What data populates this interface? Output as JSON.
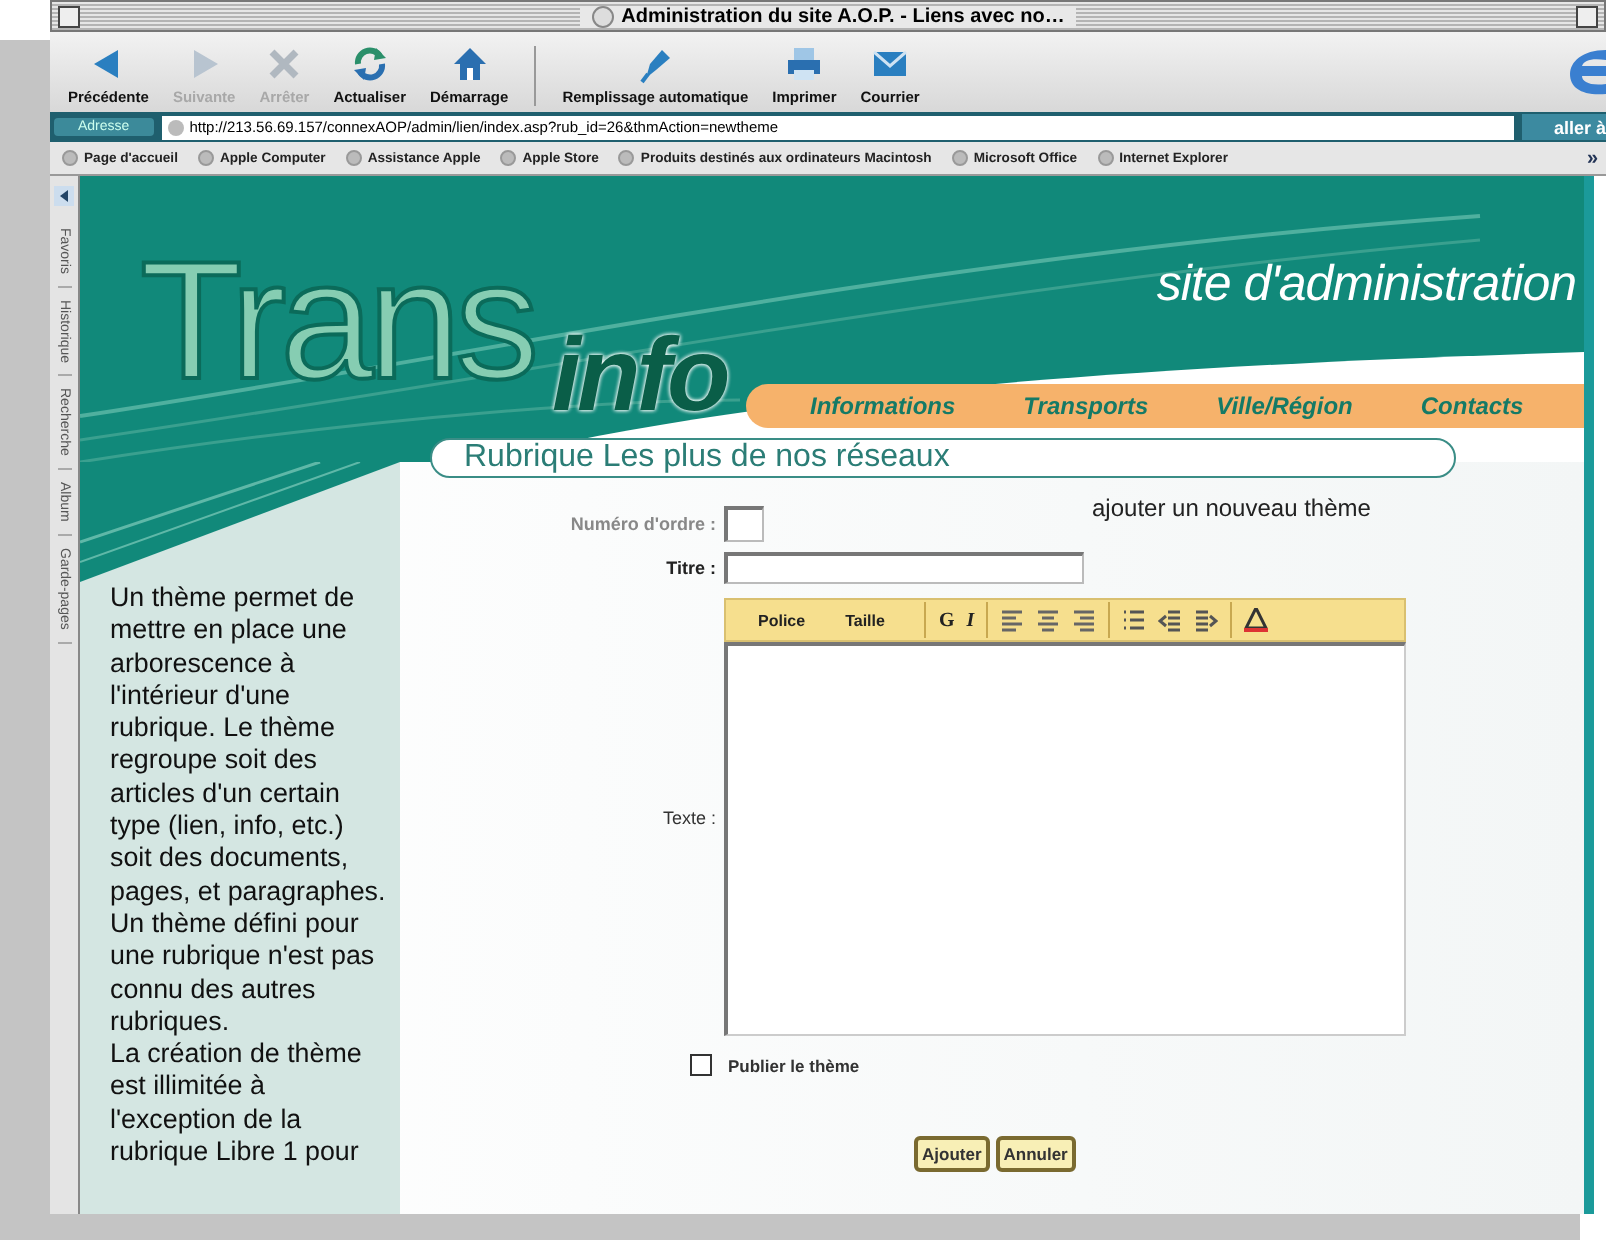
{
  "window": {
    "title": "Administration du site A.O.P. - Liens avec no…"
  },
  "toolbar": {
    "buttons": [
      {
        "label": "Précédente",
        "kind": "back",
        "disabled": false
      },
      {
        "label": "Suivante",
        "kind": "forward",
        "disabled": true
      },
      {
        "label": "Arrêter",
        "kind": "stop",
        "disabled": true
      },
      {
        "label": "Actualiser",
        "kind": "refresh",
        "disabled": false
      },
      {
        "label": "Démarrage",
        "kind": "home",
        "disabled": false
      },
      {
        "label": "Remplissage automatique",
        "kind": "autofill",
        "disabled": false
      },
      {
        "label": "Imprimer",
        "kind": "print",
        "disabled": false
      },
      {
        "label": "Courrier",
        "kind": "mail",
        "disabled": false
      }
    ]
  },
  "address_bar": {
    "label": "Adresse",
    "value": "http://213.56.69.157/connexAOP/admin/lien/index.asp?rub_id=26&thmAction=newtheme",
    "go_button": "aller à"
  },
  "favorites_bar": {
    "links": [
      "Page d'accueil",
      "Apple Computer",
      "Assistance Apple",
      "Apple Store",
      "Produits destinés aux ordinateurs Macintosh",
      "Microsoft Office",
      "Internet Explorer"
    ],
    "more": "»"
  },
  "explorer_tabs": [
    "Favoris",
    "Historique",
    "Recherche",
    "Album",
    "Garde-pages"
  ],
  "site": {
    "logo_big": "Trans",
    "logo_small": "info",
    "tagline": "site d'administration",
    "nav": [
      "Informations",
      "Transports",
      "Ville/Région",
      "Contacts"
    ]
  },
  "sidebar_text": [
    "Un thème permet de mettre en place une arborescence à l'intérieur d'une rubrique. Le thème regroupe soit des articles d'un certain type (lien, info, etc.) soit des documents, pages, et paragraphes. Un thème défini pour une rubrique n'est pas connu des autres rubriques.",
    "La création de thème est illimitée à l'exception de la rubrique Libre 1 pour"
  ],
  "form": {
    "section_title": "Rubrique Les plus de nos réseaux",
    "heading": "ajouter un nouveau thème",
    "fields": [
      {
        "label": "Numéro d'ordre :",
        "kind": "short"
      },
      {
        "label": "Titre :",
        "kind": "wide"
      }
    ],
    "editor": {
      "label": "Texte :",
      "tools": [
        {
          "kind": "menu",
          "label": "Police"
        },
        {
          "kind": "menu",
          "label": "Taille"
        },
        {
          "kind": "sep"
        },
        {
          "kind": "bold",
          "label": "G"
        },
        {
          "kind": "italic",
          "label": "I"
        },
        {
          "kind": "sep"
        },
        {
          "kind": "alignleft"
        },
        {
          "kind": "aligncenter"
        },
        {
          "kind": "alignright"
        },
        {
          "kind": "sep"
        },
        {
          "kind": "bullets"
        },
        {
          "kind": "outdent"
        },
        {
          "kind": "indent"
        },
        {
          "kind": "sep"
        },
        {
          "kind": "color"
        }
      ]
    },
    "publish": {
      "label": "Publier le thème",
      "checked": false
    },
    "buttons": [
      "Ajouter",
      "Annuler"
    ]
  }
}
